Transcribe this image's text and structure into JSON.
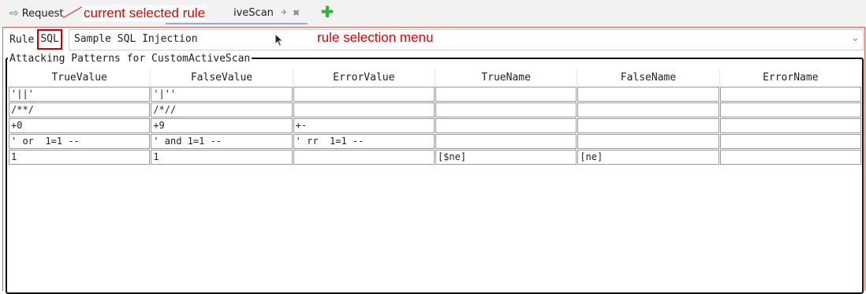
{
  "tabs": {
    "request_label": "Request",
    "active_label": "iveScan",
    "pin_glyph": "✈",
    "close_glyph": "✖",
    "add_glyph": "✚"
  },
  "annotations": {
    "current_rule": "current selected rule",
    "rule_menu": "rule selection menu"
  },
  "rule": {
    "label": "Rule",
    "selected": "SQL",
    "menu_value": "Sample SQL Injection",
    "chevron": "⌄"
  },
  "group": {
    "title": "Attacking Patterns for CustomActiveScan"
  },
  "table": {
    "headers": [
      "TrueValue",
      "FalseValue",
      "ErrorValue",
      "TrueName",
      "FalseName",
      "ErrorName"
    ],
    "rows": [
      [
        "'||'",
        "'|''",
        "",
        "",
        "",
        ""
      ],
      [
        "/**/",
        "/*//",
        "",
        "",
        "",
        ""
      ],
      [
        "+0",
        "+9",
        "+-",
        "",
        "",
        ""
      ],
      [
        "' or  1=1 --",
        "' and 1=1 --",
        "' rr  1=1 --",
        "",
        "",
        ""
      ],
      [
        "1",
        "1",
        "",
        "[$ne]",
        "[ne]",
        ""
      ]
    ]
  },
  "colors": {
    "annotation": "#e00000",
    "add_icon": "#2db52d",
    "request_arrow": "#3aa13a"
  }
}
